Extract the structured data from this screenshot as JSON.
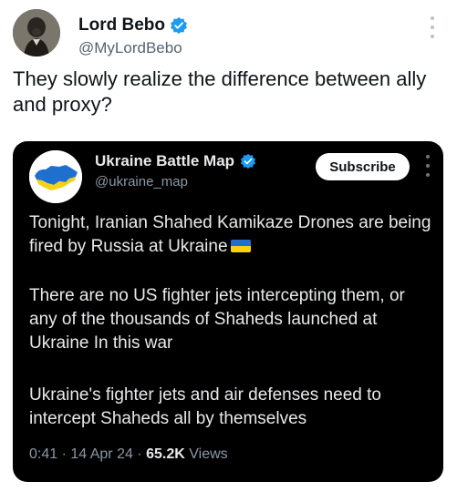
{
  "outer_tweet": {
    "name": "Lord Bebo",
    "handle": "@MyLordBebo",
    "text": "They slowly realize the difference between ally and proxy?",
    "verified_color": "#1d9bf0"
  },
  "quoted_tweet": {
    "name": "Ukraine Battle Map",
    "handle": "@ukraine_map",
    "subscribe_label": "Subscribe",
    "paragraph_1": "Tonight, Iranian Shahed Kamikaze Drones are being fired by Russia at Ukraine",
    "paragraph_2": "There are no US fighter jets intercepting them, or any of the thousands of Shaheds launched at Ukraine In this war",
    "paragraph_3": "Ukraine's fighter jets and air defenses need to intercept Shaheds all by themselves",
    "time": "0:41",
    "date": "14 Apr 24",
    "views_count": "65.2K",
    "views_label": "Views",
    "separator": "·",
    "flag_icon": "ukraine-flag-icon"
  }
}
